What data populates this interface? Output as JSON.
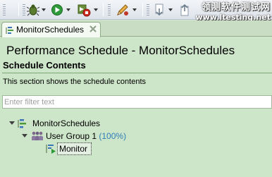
{
  "watermark": {
    "cn": "领测软件测试网",
    "url": "www.ltesting.net"
  },
  "tab": {
    "label": "MonitorSchedules"
  },
  "editor": {
    "title": "Performance Schedule - MonitorSchedules",
    "section_title": "Schedule Contents",
    "section_desc": "This section shows the schedule contents",
    "filter_placeholder": "Enter filter text"
  },
  "tree": {
    "root": "MonitorSchedules",
    "group": "User Group 1",
    "group_pct": "(100%)",
    "child": "Monitor"
  },
  "colors": {
    "editor_bg": "#cde5c8",
    "percent": "#2d7fb8",
    "tab_bg": "#f4f9f2"
  }
}
